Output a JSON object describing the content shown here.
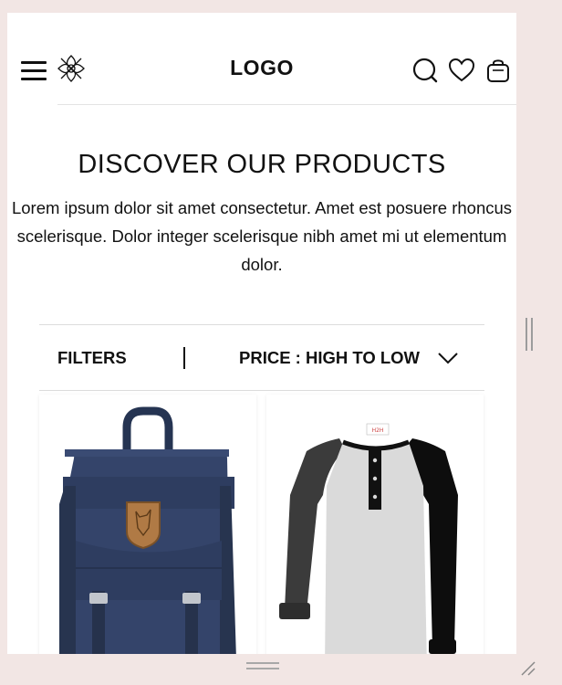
{
  "header": {
    "logo_text": "LOGO",
    "icons": [
      "menu-icon",
      "brand-flower-icon",
      "search-icon",
      "heart-icon",
      "shopping-bag-icon"
    ]
  },
  "hero": {
    "title": "DISCOVER OUR PRODUCTS",
    "description": "Lorem ipsum dolor sit amet consectetur. Amet est posuere rhoncus scelerisque. Dolor integer scelerisque nibh amet mi ut elementum dolor."
  },
  "toolbar": {
    "filters_label": "FILTERS",
    "sort_label": "PRICE : HIGH TO LOW",
    "sort_icon": "chevron-down-icon"
  },
  "products": [
    {
      "image": "navy-backpack",
      "color": "#2f3e5c"
    },
    {
      "image": "raglan-henley-shirt",
      "color": "#d9d9d9"
    }
  ],
  "colors": {
    "page_background": "#f2e6e4",
    "content_background": "#ffffff",
    "text": "#111111"
  }
}
